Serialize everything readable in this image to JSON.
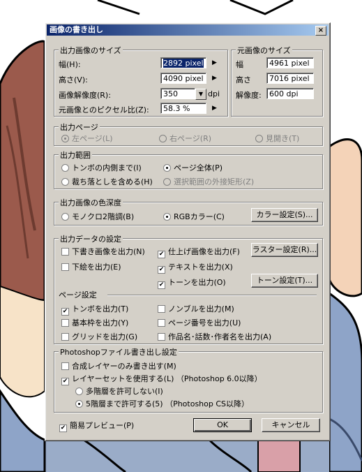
{
  "dialog": {
    "title": "画像の書き出し",
    "close_glyph": "×"
  },
  "output_size": {
    "label": "出力画像のサイズ",
    "width_label": "幅(H):",
    "width_value": "2892 pixel",
    "height_label": "高さ(V):",
    "height_value": "4090 pixel",
    "resolution_label": "画像解像度(R):",
    "resolution_value": "350",
    "resolution_unit": "dpi",
    "ratio_label": "元画像とのピクセル比(Z):",
    "ratio_value": "58.3 %"
  },
  "source_size": {
    "label": "元画像のサイズ",
    "width_label": "幅",
    "width_value": "4961 pixel",
    "height_label": "高さ",
    "height_value": "7016 pixel",
    "resolution_label": "解像度:",
    "resolution_value": "600 dpi"
  },
  "output_page": {
    "label": "出力ページ",
    "left": "左ページ(L)",
    "right": "右ページ(R)",
    "spread": "見開き(T)"
  },
  "output_range": {
    "label": "出力範囲",
    "inside_trim": "トンボの内側まで(I)",
    "whole_page": "ページ全体(P)",
    "with_bleed": "裁ち落としを含める(H)",
    "selection_rect": "選択範囲の外接矩形(Z)"
  },
  "color_depth": {
    "label": "出力画像の色深度",
    "mono": "モノクロ2階調(B)",
    "rgb": "RGBカラー(C)",
    "color_settings_button": "カラー設定(S)..."
  },
  "output_data": {
    "label": "出力データの設定",
    "draft": "下書き画像を出力(N)",
    "finished": "仕上げ画像を出力(F)",
    "raster_button": "ラスター設定(R)...",
    "underdrawing": "下絵を出力(E)",
    "text": "テキストを出力(X)",
    "tone": "トーンを出力(O)",
    "tone_button": "トーン設定(T)..."
  },
  "page_settings": {
    "label": "ページ設定",
    "trim_marks": "トンボを出力(T)",
    "nombre": "ノンブルを出力(M)",
    "basic_frame": "基本枠を出力(Y)",
    "page_number": "ページ番号を出力(U)",
    "grid": "グリッドを出力(G)",
    "work_title": "作品名･話数･作者名を出力(A)"
  },
  "photoshop": {
    "label": "Photoshopファイル書き出し設定",
    "composite_only": "合成レイヤーのみ書き出す(M)",
    "layer_sets": "レイヤーセットを使用する(L) （Photoshop 6.0以降）",
    "no_multilevel": "多階層を許可しない(I)",
    "five_levels": "5階層まで許可する(5) （Photoshop CS以降）"
  },
  "footer": {
    "preview": "簡易プレビュー(P)",
    "ok": "OK",
    "cancel": "キャンセル"
  }
}
